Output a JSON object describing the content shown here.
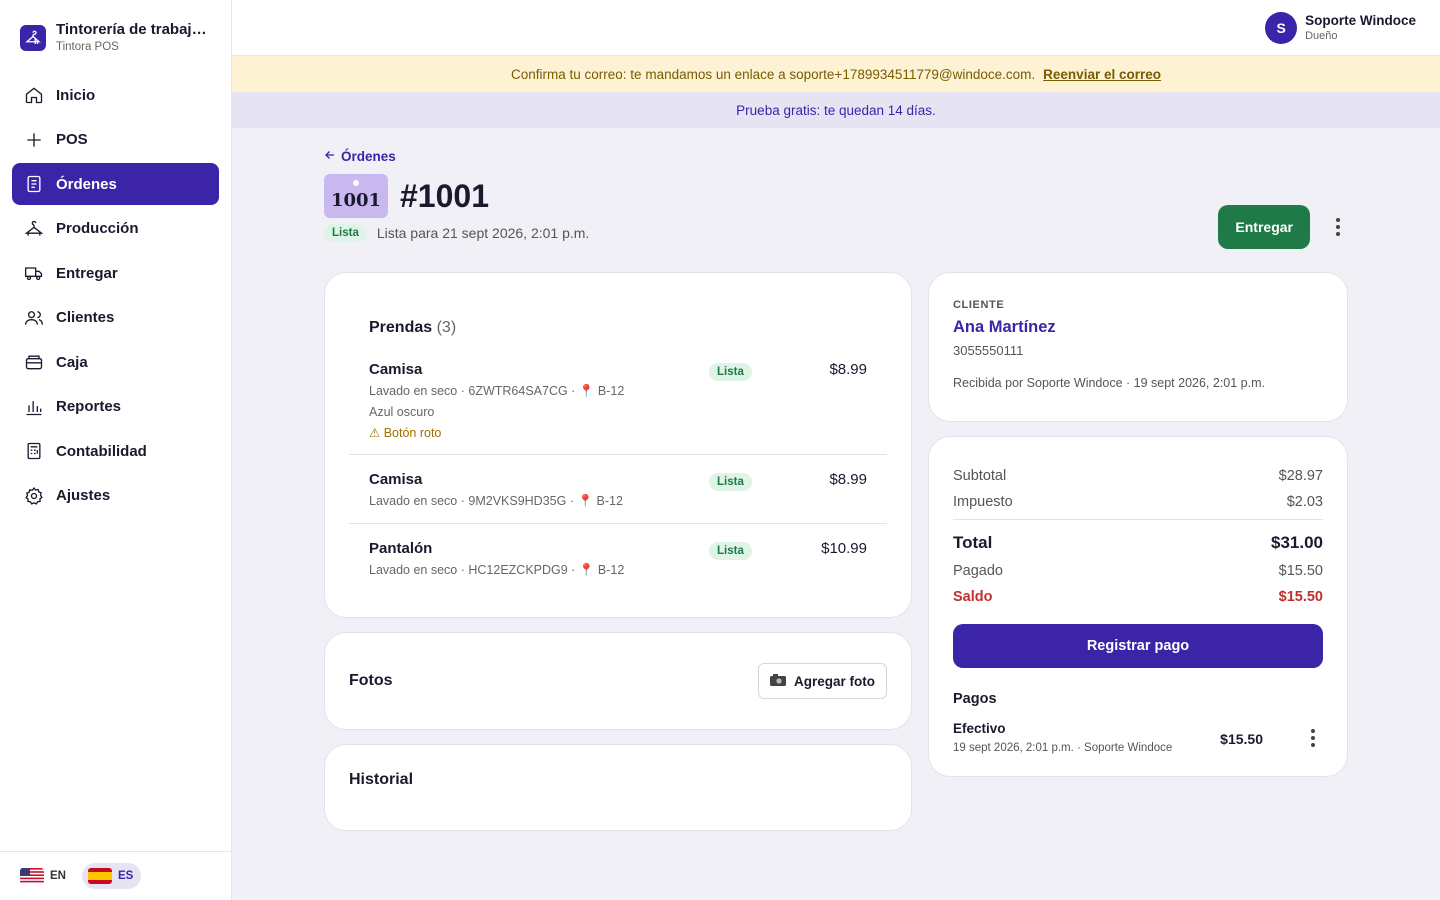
{
  "brand": {
    "name": "Tintorería de trabaj…",
    "sub": "Tintora POS"
  },
  "nav": [
    {
      "label": "Inicio",
      "icon": "home-icon"
    },
    {
      "label": "POS",
      "icon": "plus-icon"
    },
    {
      "label": "Órdenes",
      "icon": "document-icon",
      "active": true
    },
    {
      "label": "Producción",
      "icon": "hanger-icon"
    },
    {
      "label": "Entregar",
      "icon": "truck-icon"
    },
    {
      "label": "Clientes",
      "icon": "users-icon"
    },
    {
      "label": "Caja",
      "icon": "register-icon"
    },
    {
      "label": "Reportes",
      "icon": "bar-chart-icon"
    },
    {
      "label": "Contabilidad",
      "icon": "ledger-icon"
    },
    {
      "label": "Ajustes",
      "icon": "gear-icon"
    }
  ],
  "lang": {
    "en": "EN",
    "es": "ES"
  },
  "user": {
    "initial": "S",
    "name": "Soporte Windoce",
    "role": "Dueño"
  },
  "banners": {
    "warn_text": "Confirma tu correo: te mandamos un enlace a soporte+1789934511779@windoce.com.",
    "warn_link": "Reenviar el correo",
    "trial": "Prueba gratis: te quedan 14 días."
  },
  "order": {
    "back": "Órdenes",
    "tag": "1001",
    "title": "#1001",
    "status": "Lista",
    "ready_text": "Lista para 21 sept 2026, 2:01 p.m.",
    "deliver_button": "Entregar"
  },
  "items": {
    "title": "Prendas",
    "count": "(3)",
    "list": [
      {
        "name": "Camisa",
        "meta": "Lavado en seco · 6ZWTR64SA7CG ·",
        "location": "B-12",
        "note": "Azul oscuro",
        "warning": "Botón roto",
        "status": "Lista",
        "price": "$8.99"
      },
      {
        "name": "Camisa",
        "meta": "Lavado en seco · 9M2VKS9HD35G ·",
        "location": "B-12",
        "note": "",
        "warning": "",
        "status": "Lista",
        "price": "$8.99"
      },
      {
        "name": "Pantalón",
        "meta": "Lavado en seco · HC12EZCKPDG9 ·",
        "location": "B-12",
        "note": "",
        "warning": "",
        "status": "Lista",
        "price": "$10.99"
      }
    ]
  },
  "photos": {
    "title": "Fotos",
    "add_button": "Agregar foto"
  },
  "history": {
    "title": "Historial"
  },
  "client": {
    "label": "CLIENTE",
    "name": "Ana Martínez",
    "phone": "3055550111",
    "received": "Recibida por Soporte Windoce · 19 sept 2026, 2:01 p.m."
  },
  "totals": {
    "subtotal_label": "Subtotal",
    "subtotal": "$28.97",
    "tax_label": "Impuesto",
    "tax": "$2.03",
    "total_label": "Total",
    "total": "$31.00",
    "paid_label": "Pagado",
    "paid": "$15.50",
    "balance_label": "Saldo",
    "balance": "$15.50",
    "pay_button": "Registrar pago"
  },
  "payments": {
    "title": "Pagos",
    "list": [
      {
        "method": "Efectivo",
        "meta": "19 sept 2026, 2:01 p.m. · Soporte Windoce",
        "amount": "$15.50"
      }
    ]
  },
  "colors": {
    "primary": "#3b24a8",
    "success": "#1e7a46",
    "danger": "#c03030",
    "warn_bg": "#fdf3d4"
  }
}
